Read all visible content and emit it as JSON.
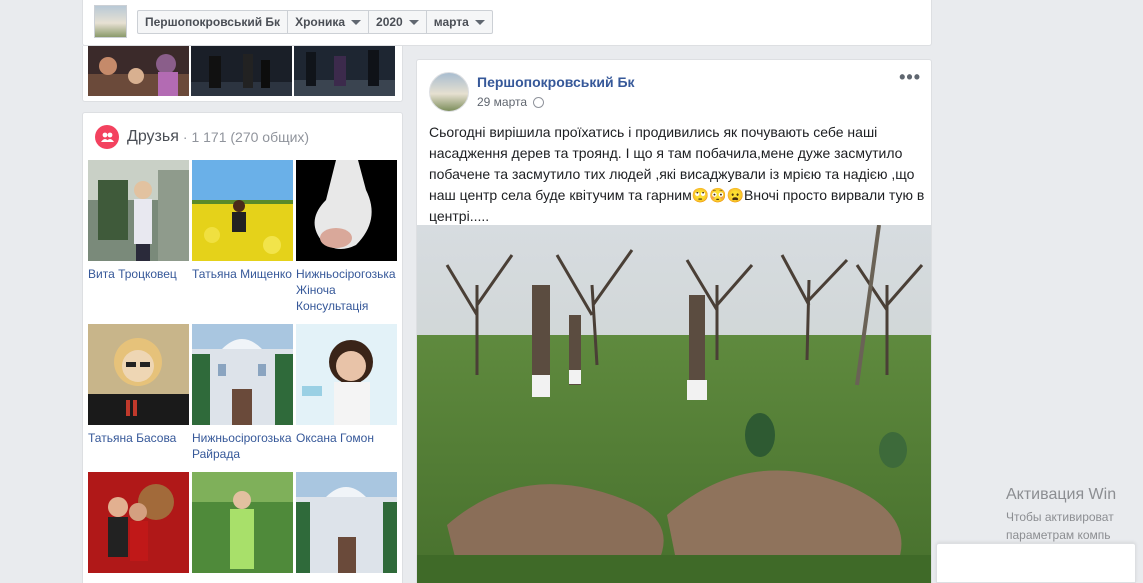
{
  "header": {
    "page_name": "Першопокровський Бк",
    "filters": [
      {
        "label": "Хроника"
      },
      {
        "label": "2020"
      },
      {
        "label": "марта"
      }
    ]
  },
  "friends": {
    "title": "Друзья",
    "count": "· 1 171 (270 общих)",
    "items": [
      {
        "name": "Вита Троцковец"
      },
      {
        "name": "Татьяна Мищенко"
      },
      {
        "name": "Нижньосірогозька Жіноча Консультація"
      },
      {
        "name": "Татьяна Басова"
      },
      {
        "name": "Нижньосірогозька Райрада"
      },
      {
        "name": "Оксана Гомон"
      },
      {
        "name": ""
      },
      {
        "name": ""
      },
      {
        "name": ""
      }
    ]
  },
  "post": {
    "author": "Першопокровський Бк",
    "date": "29 марта",
    "text": "Сьогодні вирішила проїхатись і продивились як почувають себе наші насадження дерев та троянд. І що я там побачила,мене дуже засмутило побачене та засмутило тих людей ,які висаджували із мрією та надією ,що наш центр села буде квітучим та гарним🙄😳😦Вночі просто вирвали тую в центрі....."
  },
  "watermark": {
    "title": "Активация Win",
    "line1": "Чтобы активироват",
    "line2": "параметрам компь"
  },
  "icons": {
    "friends": "friends-icon",
    "globe": "globe-icon",
    "more": "more-options-icon",
    "caret": "caret-down-icon"
  },
  "colors": {
    "link": "#365899",
    "friends_badge": "#f3425f",
    "background": "#e9ebee"
  }
}
